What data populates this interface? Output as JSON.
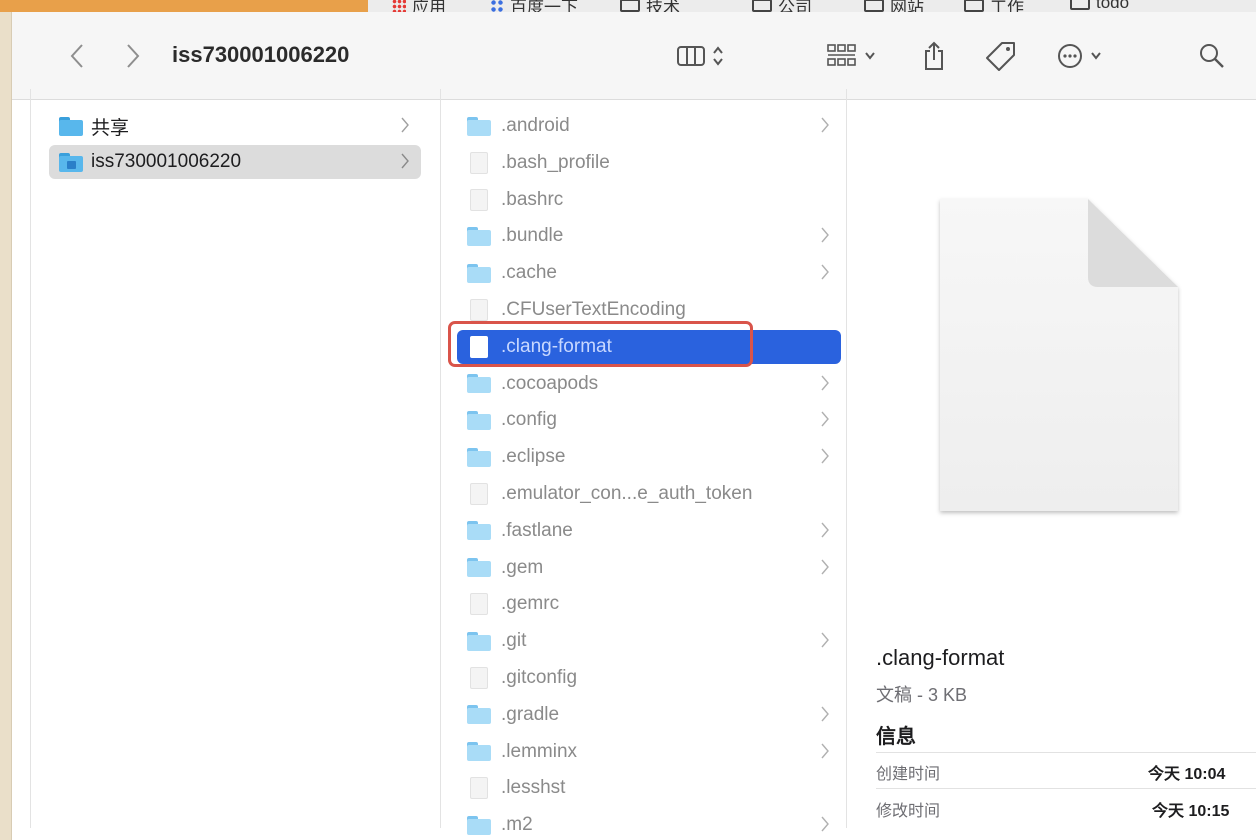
{
  "bookmarks_bar": {
    "items": [
      {
        "label": "应用",
        "icon": "apps-grid-icon"
      },
      {
        "label": "百度一下",
        "icon": "baidu-paw-icon"
      },
      {
        "label": "技术",
        "icon": "folder-icon"
      },
      {
        "label": "公司",
        "icon": "folder-icon"
      },
      {
        "label": "网站",
        "icon": "folder-icon"
      },
      {
        "label": "工作",
        "icon": "folder-icon"
      },
      {
        "label": "todo",
        "icon": "folder-icon"
      }
    ]
  },
  "window": {
    "title": "iss730001006220",
    "toolbar": {
      "back_icon": "chevron-left-icon",
      "forward_icon": "chevron-right-icon",
      "view_icon": "column-view-icon",
      "group_icon": "group-grid-icon",
      "share_icon": "share-icon",
      "tag_icon": "tag-icon",
      "more_icon": "ellipsis-circle-icon",
      "search_icon": "search-icon"
    }
  },
  "sidebar_column": {
    "items": [
      {
        "label": "共享",
        "icon": "folder-icon",
        "has_children": true,
        "selected": false
      },
      {
        "label": "iss730001006220",
        "icon": "home-folder-icon",
        "has_children": true,
        "selected": true
      }
    ]
  },
  "files_column": {
    "items": [
      {
        "label": ".android",
        "type": "folder",
        "has_children": true
      },
      {
        "label": ".bash_profile",
        "type": "file",
        "has_children": false
      },
      {
        "label": ".bashrc",
        "type": "file",
        "has_children": false
      },
      {
        "label": ".bundle",
        "type": "folder",
        "has_children": true
      },
      {
        "label": ".cache",
        "type": "folder",
        "has_children": true
      },
      {
        "label": ".CFUserTextEncoding",
        "type": "file",
        "has_children": false
      },
      {
        "label": ".clang-format",
        "type": "file",
        "has_children": false,
        "selected": true
      },
      {
        "label": ".cocoapods",
        "type": "folder",
        "has_children": true
      },
      {
        "label": ".config",
        "type": "folder",
        "has_children": true
      },
      {
        "label": ".eclipse",
        "type": "folder",
        "has_children": true
      },
      {
        "label": ".emulator_con...e_auth_token",
        "type": "file",
        "has_children": false
      },
      {
        "label": ".fastlane",
        "type": "folder",
        "has_children": true
      },
      {
        "label": ".gem",
        "type": "folder",
        "has_children": true
      },
      {
        "label": ".gemrc",
        "type": "file",
        "has_children": false
      },
      {
        "label": ".git",
        "type": "folder",
        "has_children": true
      },
      {
        "label": ".gitconfig",
        "type": "file",
        "has_children": false
      },
      {
        "label": ".gradle",
        "type": "folder",
        "has_children": true
      },
      {
        "label": ".lemminx",
        "type": "folder",
        "has_children": true
      },
      {
        "label": ".lesshst",
        "type": "file",
        "has_children": false
      },
      {
        "label": ".m2",
        "type": "folder",
        "has_children": true
      }
    ]
  },
  "preview": {
    "icon": "document-preview-icon",
    "name": ".clang-format",
    "kind": "文稿 - 3 KB",
    "info_heading": "信息",
    "rows": [
      {
        "key": "创建时间",
        "value": "今天 10:04"
      },
      {
        "key": "修改时间",
        "value": "今天 10:15"
      }
    ]
  },
  "colors": {
    "selection_blue": "#2a62de",
    "highlight_red": "#d9544a",
    "sidebar_selection": "#dcdcdc"
  }
}
